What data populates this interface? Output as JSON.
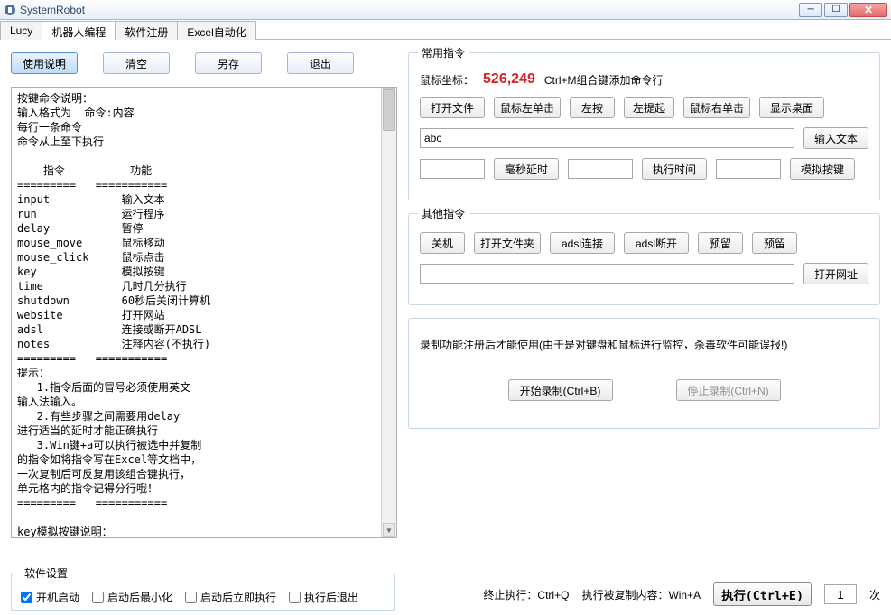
{
  "window": {
    "title": "SystemRobot"
  },
  "tabs": {
    "t0": "Lucy",
    "t1": "机器人编程",
    "t2": "软件注册",
    "t3": "Excel自动化"
  },
  "toolbar": {
    "help": "使用说明",
    "clear": "清空",
    "saveas": "另存",
    "exit": "退出"
  },
  "script_text": "按键命令说明：\n输入格式为  命令:内容\n每行一条命令\n命令从上至下执行\n\n    指令          功能\n=========   ===========\ninput           输入文本\nrun             运行程序\ndelay           暂停\nmouse_move      鼠标移动\nmouse_click     鼠标点击\nkey             模拟按键\ntime            几时几分执行\nshutdown        60秒后关闭计算机\nwebsite         打开网站\nadsl            连接或断开ADSL\nnotes           注释内容(不执行)\n=========   ===========\n提示：\n   1.指令后面的冒号必须使用英文\n输入法输入。\n   2.有些步骤之间需要用delay\n进行适当的延时才能正确执行\n   3.Win键+a可以执行被选中并复制\n的指令如将指令写在Excel等文档中，\n一次复制后可反复用该组合键执行，\n单元格内的指令记得分行哦！\n=========   ===========\n\nkey模拟按键说明：\n\n    键          代码\n=========   ===========",
  "common": {
    "legend": "常用指令",
    "coord_label": "鼠标坐标：",
    "coord_value": "526,249",
    "hint": "Ctrl+M组合键添加命令行",
    "open_file": "打开文件",
    "left_click": "鼠标左单击",
    "left_press": "左按",
    "left_release": "左提起",
    "right_click": "鼠标右单击",
    "show_desktop": "显示桌面",
    "sample_text": "abc",
    "input_text_btn": "输入文本",
    "ms_delay": "毫秒延时",
    "exec_time": "执行时间",
    "sim_key": "模拟按键"
  },
  "other": {
    "legend": "其他指令",
    "shutdown": "关机",
    "open_folder": "打开文件夹",
    "adsl_connect": "adsl连接",
    "adsl_disconnect": "adsl断开",
    "reserve1": "预留",
    "reserve2": "预留",
    "open_site": "打开网址"
  },
  "record": {
    "title": "录制功能注册后才能使用(由于是对键盘和鼠标进行监控，杀毒软件可能误报!)",
    "start": "开始录制(Ctrl+B)",
    "stop": "停止录制(Ctrl+N)"
  },
  "settings": {
    "legend": "软件设置",
    "boot": "开机启动",
    "minimize": "启动后最小化",
    "run_now": "启动后立即执行",
    "exit_after": "执行后退出"
  },
  "footer": {
    "stop_label": "终止执行：Ctrl+Q",
    "copy_label": "执行被复制内容：Win+A",
    "exec_btn": "执行(Ctrl+E)",
    "count": "1",
    "times": "次"
  }
}
